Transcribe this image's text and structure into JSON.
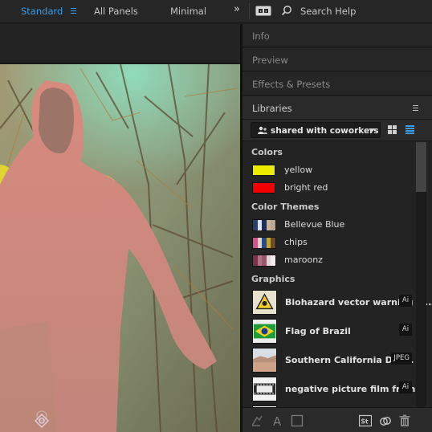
{
  "workspaces": {
    "standard": "Standard",
    "all_panels": "All Panels",
    "minimal": "Minimal",
    "more": "»"
  },
  "search": {
    "placeholder": "Search Help"
  },
  "panels": {
    "info": "Info",
    "preview": "Preview",
    "effects": "Effects & Presets",
    "libraries": "Libraries"
  },
  "library": {
    "selected": "shared with coworkers",
    "sections": {
      "colors": "Colors",
      "themes": "Color Themes",
      "graphics": "Graphics"
    },
    "colors": [
      {
        "name": "yellow",
        "hex": "#ecec00"
      },
      {
        "name": "bright red",
        "hex": "#f20000"
      }
    ],
    "themes": [
      {
        "name": "Bellevue Blue",
        "swatches": [
          "#2c3c6c",
          "#dfe3ea",
          "#1d2f5a",
          "#c8b49a",
          "#b7a896"
        ]
      },
      {
        "name": "chips",
        "swatches": [
          "#d0538c",
          "#e0d4c4",
          "#2b4a8e",
          "#c2a434",
          "#6a4a2e"
        ]
      },
      {
        "name": "maroonz",
        "swatches": [
          "#7a3248",
          "#b07288",
          "#9c5468",
          "#e4d4da",
          "#f2ecec"
        ]
      }
    ],
    "graphics": [
      {
        "name": "Biohazard vector warning s...",
        "type": "Ai",
        "icon": "biohazard-thumbnail"
      },
      {
        "name": "Flag of Brazil",
        "type": "Ai",
        "icon": "brazil-flag-thumbnail"
      },
      {
        "name": "Southern California Des...",
        "type": "JPEG",
        "icon": "desert-photo-thumbnail"
      },
      {
        "name": "negative picture film fram...",
        "type": "Ai",
        "icon": "film-frame-thumbnail"
      }
    ]
  },
  "footer_icons": [
    "add-graphic-icon",
    "add-text-style-icon",
    "add-layer-icon",
    "stock-icon",
    "creative-cloud-icon",
    "trash-icon"
  ]
}
